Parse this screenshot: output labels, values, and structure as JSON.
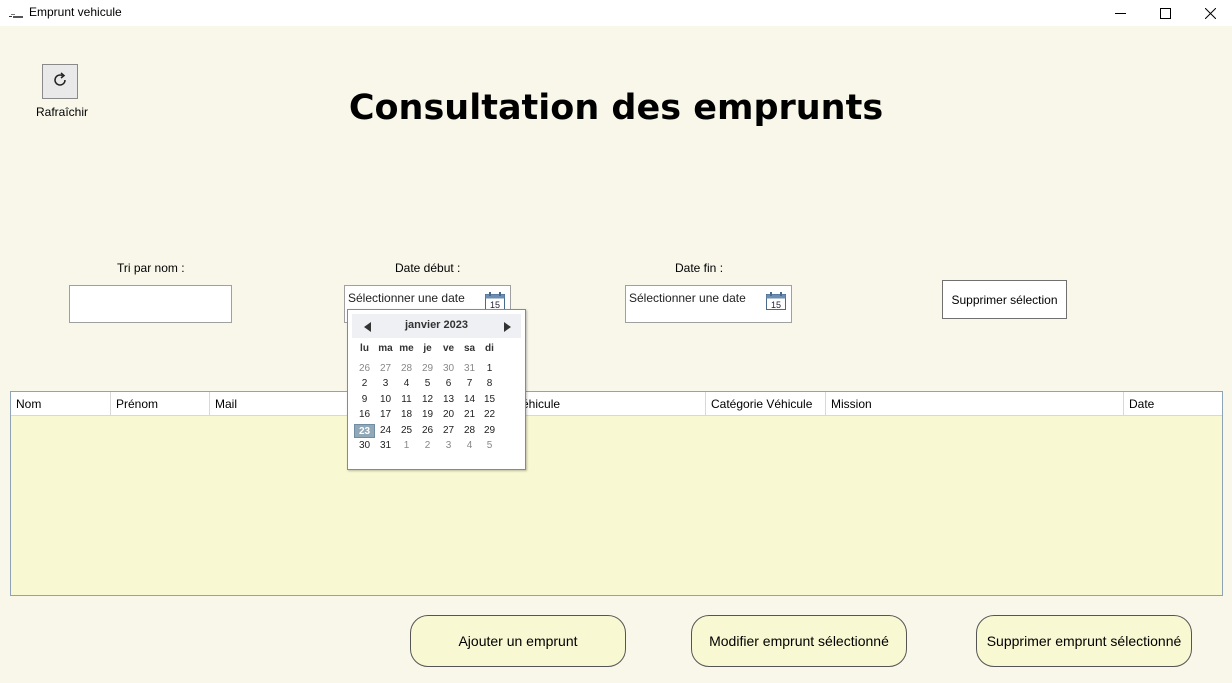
{
  "window": {
    "title": "Emprunt vehicule",
    "minimize_icon": "minimize-icon",
    "maximize_icon": "maximize-icon",
    "close_icon": "close-icon"
  },
  "toolbar": {
    "refresh_label": "Rafraîchir",
    "refresh_icon": "refresh-icon"
  },
  "page_title": "Consultation des emprunts",
  "filters": {
    "name_label": "Tri par nom :",
    "name_value": "",
    "start_date_label": "Date début :",
    "start_date_placeholder": "Sélectionner une date",
    "end_date_label": "Date fin :",
    "end_date_placeholder": "Sélectionner une date",
    "calendar_icon_text": "15",
    "clear_selection_label": "Supprimer sélection"
  },
  "calendar": {
    "month": "janvier 2023",
    "days_of_week": [
      "lu",
      "ma",
      "me",
      "je",
      "ve",
      "sa",
      "di"
    ],
    "weeks": [
      [
        {
          "d": "26",
          "o": true
        },
        {
          "d": "27",
          "o": true
        },
        {
          "d": "28",
          "o": true
        },
        {
          "d": "29",
          "o": true
        },
        {
          "d": "30",
          "o": true
        },
        {
          "d": "31",
          "o": true
        },
        {
          "d": "1",
          "o": false
        }
      ],
      [
        {
          "d": "2",
          "o": false
        },
        {
          "d": "3",
          "o": false
        },
        {
          "d": "4",
          "o": false
        },
        {
          "d": "5",
          "o": false
        },
        {
          "d": "6",
          "o": false
        },
        {
          "d": "7",
          "o": false
        },
        {
          "d": "8",
          "o": false
        }
      ],
      [
        {
          "d": "9",
          "o": false
        },
        {
          "d": "10",
          "o": false
        },
        {
          "d": "11",
          "o": false
        },
        {
          "d": "12",
          "o": false
        },
        {
          "d": "13",
          "o": false
        },
        {
          "d": "14",
          "o": false
        },
        {
          "d": "15",
          "o": false
        }
      ],
      [
        {
          "d": "16",
          "o": false
        },
        {
          "d": "17",
          "o": false
        },
        {
          "d": "18",
          "o": false
        },
        {
          "d": "19",
          "o": false
        },
        {
          "d": "20",
          "o": false
        },
        {
          "d": "21",
          "o": false
        },
        {
          "d": "22",
          "o": false
        }
      ],
      [
        {
          "d": "23",
          "o": false,
          "today": true
        },
        {
          "d": "24",
          "o": false
        },
        {
          "d": "25",
          "o": false
        },
        {
          "d": "26",
          "o": false
        },
        {
          "d": "27",
          "o": false
        },
        {
          "d": "28",
          "o": false
        },
        {
          "d": "29",
          "o": false
        }
      ],
      [
        {
          "d": "30",
          "o": false
        },
        {
          "d": "31",
          "o": false
        },
        {
          "d": "1",
          "o": true
        },
        {
          "d": "2",
          "o": true
        },
        {
          "d": "3",
          "o": true
        },
        {
          "d": "4",
          "o": true
        },
        {
          "d": "5",
          "o": true
        }
      ]
    ]
  },
  "grid": {
    "columns": [
      "Nom",
      "Prénom",
      "Mail",
      "Véhicule",
      "Catégorie Véhicule",
      "Mission",
      "Date"
    ],
    "rows": []
  },
  "actions": {
    "add_label": "Ajouter un emprunt",
    "edit_label": "Modifier emprunt sélectionné",
    "delete_label": "Supprimer emprunt sélectionné"
  },
  "colors": {
    "background": "#f9f7ea",
    "grid_body": "#f8f8d2",
    "button_fill": "#f8f8d2",
    "calendar_today": "#90a8b8"
  }
}
